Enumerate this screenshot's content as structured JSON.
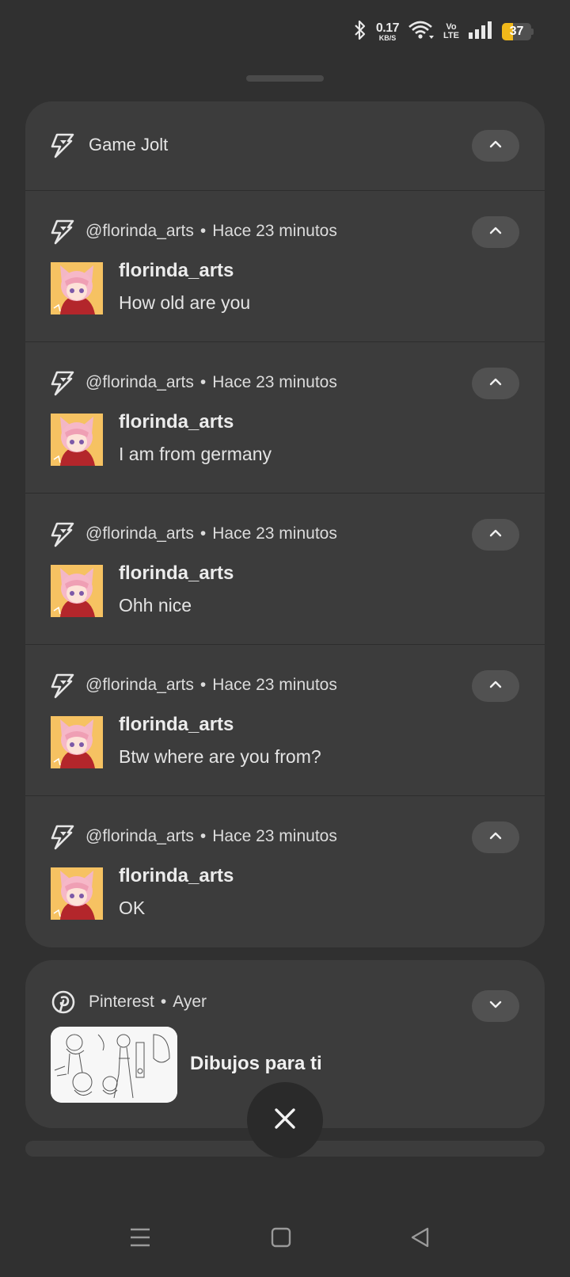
{
  "status_bar": {
    "speed_value": "0.17",
    "speed_unit": "KB/S",
    "volte_top": "Vo",
    "volte_bottom": "LTE",
    "battery": "37",
    "battery_level": 0.37,
    "battery_color": "#f0b81a"
  },
  "gamejolt": {
    "app_name": "Game Jolt",
    "notifications": [
      {
        "account": "@florinda_arts",
        "time": "Hace 23 minutos",
        "sender": "florinda_arts",
        "message": "How old are you"
      },
      {
        "account": "@florinda_arts",
        "time": "Hace 23 minutos",
        "sender": "florinda_arts",
        "message": "I am from germany"
      },
      {
        "account": "@florinda_arts",
        "time": "Hace 23 minutos",
        "sender": "florinda_arts",
        "message": "Ohh nice"
      },
      {
        "account": "@florinda_arts",
        "time": "Hace 23 minutos",
        "sender": "florinda_arts",
        "message": "Btw where are you from?"
      },
      {
        "account": "@florinda_arts",
        "time": "Hace 23 minutos",
        "sender": "florinda_arts",
        "message": "OK"
      }
    ]
  },
  "pinterest": {
    "app_name": "Pinterest",
    "time": "Ayer",
    "title": "Dibujos para ti"
  },
  "separator": "•",
  "icons": {
    "game_jolt": "game-jolt-bolt-icon",
    "pinterest": "pinterest-icon",
    "collapse": "chevron-up-icon",
    "expand": "chevron-down-icon",
    "close": "close-icon",
    "nav": [
      "menu-icon",
      "home-icon",
      "back-icon"
    ]
  }
}
